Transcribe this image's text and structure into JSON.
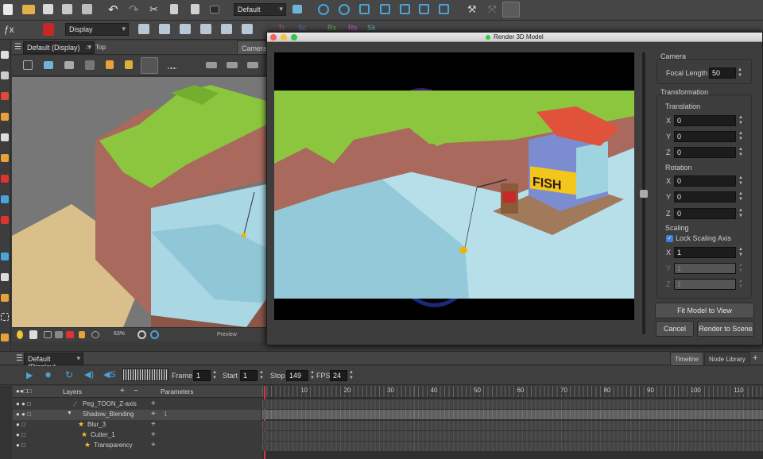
{
  "toolbar": {
    "set_dropdown": "Default",
    "display_dropdown": "Display",
    "plugin_letters": [
      "Tr",
      "Sc",
      "Rx",
      "Re",
      "Sk"
    ]
  },
  "left_view": {
    "workspace_dropdown": "Default (Display)",
    "top_label": "Top",
    "camera_tab": "Camera",
    "zoom": "63%",
    "preview_label": "Preview"
  },
  "dialog": {
    "title": "Render 3D Model",
    "camera_section": "Camera",
    "focal_length_label": "Focal Length",
    "focal_length": "50",
    "transformation_section": "Transformation",
    "translation_label": "Translation",
    "translation": [
      {
        "axis": "X",
        "value": "0"
      },
      {
        "axis": "Y",
        "value": "0"
      },
      {
        "axis": "Z",
        "value": "0"
      }
    ],
    "rotation_label": "Rotation",
    "rotation": [
      {
        "axis": "X",
        "value": "0"
      },
      {
        "axis": "Y",
        "value": "0"
      },
      {
        "axis": "Z",
        "value": "0"
      }
    ],
    "scaling_label": "Scaling",
    "lock_scaling_label": "Lock Scaling Axis",
    "lock_scaling_checked": true,
    "scaling": [
      {
        "axis": "X",
        "value": "1"
      },
      {
        "axis": "Y",
        "value": "1"
      },
      {
        "axis": "Z",
        "value": "1"
      }
    ],
    "fit_button": "Fit Model to View",
    "cancel_button": "Cancel",
    "render_button": "Render to Scene",
    "sign_text": "FISH"
  },
  "timeline": {
    "workspace_dropdown": "Default (Display)",
    "tab_timeline": "Timeline",
    "tab_node_library": "Node Library",
    "frame_label": "Frame",
    "frame_value": "1",
    "start_label": "Start",
    "start_value": "1",
    "stop_label": "Stop",
    "stop_value": "149",
    "fps_label": "FPS",
    "fps_value": "24",
    "layers_header": "Layers",
    "parameters_header": "Parameters",
    "layers": [
      {
        "name": "Peg_TOON_Z-axis",
        "indent": 0,
        "param": ""
      },
      {
        "name": "Shadow_Blending",
        "indent": 1,
        "param": "1"
      },
      {
        "name": "Blur_3",
        "indent": 2,
        "param": ""
      },
      {
        "name": "Cutter_1",
        "indent": 2,
        "param": ""
      },
      {
        "name": "Transparency",
        "indent": 3,
        "param": ""
      }
    ],
    "ruler": [
      "10",
      "20",
      "30",
      "40",
      "50",
      "60",
      "70",
      "80",
      "90",
      "100",
      "110"
    ]
  }
}
